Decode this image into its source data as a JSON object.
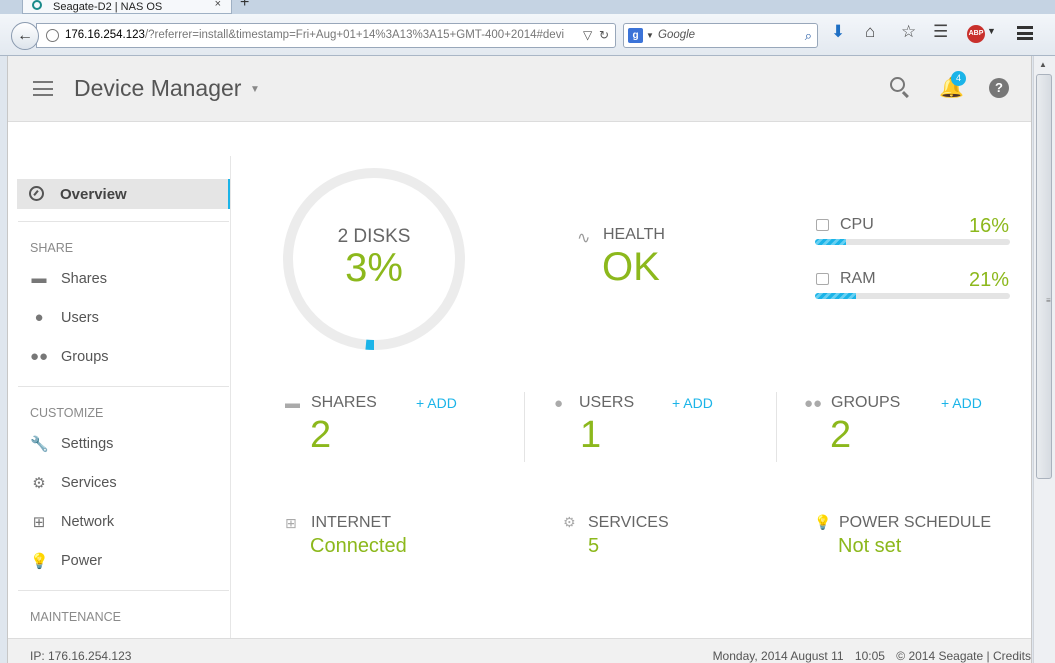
{
  "browser": {
    "tab_title": "Seagate-D2 | NAS OS",
    "tab_close": "×",
    "new_tab": "+",
    "url_host": "176.16.254.123",
    "url_rest": "/?referrer=install&timestamp=Fri+Aug+01+14%3A13%3A15+GMT-400+2014#devi",
    "search_placeholder": "Google",
    "search_engine_letter": "g",
    "abp_label": "ABP"
  },
  "app": {
    "title": "Device Manager",
    "notification_count": "4",
    "help_label": "?"
  },
  "sidebar": {
    "active": "Overview",
    "sections": [
      {
        "heading": "SHARE",
        "items": [
          {
            "label": "Shares",
            "icon": "folder-icon"
          },
          {
            "label": "Users",
            "icon": "user-icon"
          },
          {
            "label": "Groups",
            "icon": "group-icon"
          }
        ]
      },
      {
        "heading": "CUSTOMIZE",
        "items": [
          {
            "label": "Settings",
            "icon": "wrench-icon"
          },
          {
            "label": "Services",
            "icon": "gear-icon"
          },
          {
            "label": "Network",
            "icon": "network-icon"
          },
          {
            "label": "Power",
            "icon": "bulb-icon"
          }
        ]
      },
      {
        "heading": "MAINTENANCE",
        "items": []
      }
    ]
  },
  "dashboard": {
    "disks": {
      "label": "2 DISKS",
      "percent": "3%",
      "fill_fraction": 0.03
    },
    "health": {
      "label": "HEALTH",
      "value": "OK"
    },
    "cpu": {
      "label": "CPU",
      "value": "16%",
      "fill_fraction": 0.16
    },
    "ram": {
      "label": "RAM",
      "value": "21%",
      "fill_fraction": 0.21
    },
    "shares": {
      "label": "SHARES",
      "add": "+ ADD",
      "value": "2"
    },
    "users": {
      "label": "USERS",
      "add": "+ ADD",
      "value": "1"
    },
    "groups": {
      "label": "GROUPS",
      "add": "+ ADD",
      "value": "2"
    },
    "internet": {
      "label": "INTERNET",
      "value": "Connected"
    },
    "services": {
      "label": "SERVICES",
      "value": "5"
    },
    "power_schedule": {
      "label": "POWER SCHEDULE",
      "value": "Not set"
    }
  },
  "footer": {
    "ip": "IP: 176.16.254.123",
    "date": "Monday, 2014 August 11",
    "time": "10:05",
    "copyright": "© 2014 Seagate | Credits"
  },
  "colors": {
    "accent_blue": "#1bb4e8",
    "value_green": "#8cb81c"
  }
}
